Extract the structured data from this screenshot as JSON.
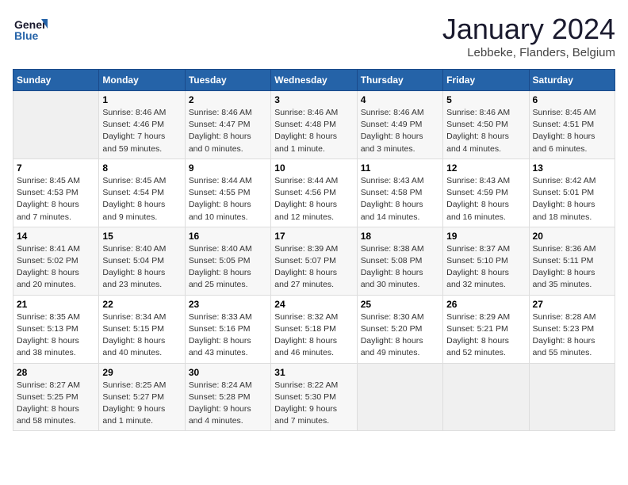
{
  "header": {
    "logo_line1": "General",
    "logo_line2": "Blue",
    "main_title": "January 2024",
    "subtitle": "Lebbeke, Flanders, Belgium"
  },
  "days_of_week": [
    "Sunday",
    "Monday",
    "Tuesday",
    "Wednesday",
    "Thursday",
    "Friday",
    "Saturday"
  ],
  "weeks": [
    [
      {
        "num": "",
        "info": ""
      },
      {
        "num": "1",
        "info": "Sunrise: 8:46 AM\nSunset: 4:46 PM\nDaylight: 7 hours\nand 59 minutes."
      },
      {
        "num": "2",
        "info": "Sunrise: 8:46 AM\nSunset: 4:47 PM\nDaylight: 8 hours\nand 0 minutes."
      },
      {
        "num": "3",
        "info": "Sunrise: 8:46 AM\nSunset: 4:48 PM\nDaylight: 8 hours\nand 1 minute."
      },
      {
        "num": "4",
        "info": "Sunrise: 8:46 AM\nSunset: 4:49 PM\nDaylight: 8 hours\nand 3 minutes."
      },
      {
        "num": "5",
        "info": "Sunrise: 8:46 AM\nSunset: 4:50 PM\nDaylight: 8 hours\nand 4 minutes."
      },
      {
        "num": "6",
        "info": "Sunrise: 8:45 AM\nSunset: 4:51 PM\nDaylight: 8 hours\nand 6 minutes."
      }
    ],
    [
      {
        "num": "7",
        "info": "Sunrise: 8:45 AM\nSunset: 4:53 PM\nDaylight: 8 hours\nand 7 minutes."
      },
      {
        "num": "8",
        "info": "Sunrise: 8:45 AM\nSunset: 4:54 PM\nDaylight: 8 hours\nand 9 minutes."
      },
      {
        "num": "9",
        "info": "Sunrise: 8:44 AM\nSunset: 4:55 PM\nDaylight: 8 hours\nand 10 minutes."
      },
      {
        "num": "10",
        "info": "Sunrise: 8:44 AM\nSunset: 4:56 PM\nDaylight: 8 hours\nand 12 minutes."
      },
      {
        "num": "11",
        "info": "Sunrise: 8:43 AM\nSunset: 4:58 PM\nDaylight: 8 hours\nand 14 minutes."
      },
      {
        "num": "12",
        "info": "Sunrise: 8:43 AM\nSunset: 4:59 PM\nDaylight: 8 hours\nand 16 minutes."
      },
      {
        "num": "13",
        "info": "Sunrise: 8:42 AM\nSunset: 5:01 PM\nDaylight: 8 hours\nand 18 minutes."
      }
    ],
    [
      {
        "num": "14",
        "info": "Sunrise: 8:41 AM\nSunset: 5:02 PM\nDaylight: 8 hours\nand 20 minutes."
      },
      {
        "num": "15",
        "info": "Sunrise: 8:40 AM\nSunset: 5:04 PM\nDaylight: 8 hours\nand 23 minutes."
      },
      {
        "num": "16",
        "info": "Sunrise: 8:40 AM\nSunset: 5:05 PM\nDaylight: 8 hours\nand 25 minutes."
      },
      {
        "num": "17",
        "info": "Sunrise: 8:39 AM\nSunset: 5:07 PM\nDaylight: 8 hours\nand 27 minutes."
      },
      {
        "num": "18",
        "info": "Sunrise: 8:38 AM\nSunset: 5:08 PM\nDaylight: 8 hours\nand 30 minutes."
      },
      {
        "num": "19",
        "info": "Sunrise: 8:37 AM\nSunset: 5:10 PM\nDaylight: 8 hours\nand 32 minutes."
      },
      {
        "num": "20",
        "info": "Sunrise: 8:36 AM\nSunset: 5:11 PM\nDaylight: 8 hours\nand 35 minutes."
      }
    ],
    [
      {
        "num": "21",
        "info": "Sunrise: 8:35 AM\nSunset: 5:13 PM\nDaylight: 8 hours\nand 38 minutes."
      },
      {
        "num": "22",
        "info": "Sunrise: 8:34 AM\nSunset: 5:15 PM\nDaylight: 8 hours\nand 40 minutes."
      },
      {
        "num": "23",
        "info": "Sunrise: 8:33 AM\nSunset: 5:16 PM\nDaylight: 8 hours\nand 43 minutes."
      },
      {
        "num": "24",
        "info": "Sunrise: 8:32 AM\nSunset: 5:18 PM\nDaylight: 8 hours\nand 46 minutes."
      },
      {
        "num": "25",
        "info": "Sunrise: 8:30 AM\nSunset: 5:20 PM\nDaylight: 8 hours\nand 49 minutes."
      },
      {
        "num": "26",
        "info": "Sunrise: 8:29 AM\nSunset: 5:21 PM\nDaylight: 8 hours\nand 52 minutes."
      },
      {
        "num": "27",
        "info": "Sunrise: 8:28 AM\nSunset: 5:23 PM\nDaylight: 8 hours\nand 55 minutes."
      }
    ],
    [
      {
        "num": "28",
        "info": "Sunrise: 8:27 AM\nSunset: 5:25 PM\nDaylight: 8 hours\nand 58 minutes."
      },
      {
        "num": "29",
        "info": "Sunrise: 8:25 AM\nSunset: 5:27 PM\nDaylight: 9 hours\nand 1 minute."
      },
      {
        "num": "30",
        "info": "Sunrise: 8:24 AM\nSunset: 5:28 PM\nDaylight: 9 hours\nand 4 minutes."
      },
      {
        "num": "31",
        "info": "Sunrise: 8:22 AM\nSunset: 5:30 PM\nDaylight: 9 hours\nand 7 minutes."
      },
      {
        "num": "",
        "info": ""
      },
      {
        "num": "",
        "info": ""
      },
      {
        "num": "",
        "info": ""
      }
    ]
  ]
}
